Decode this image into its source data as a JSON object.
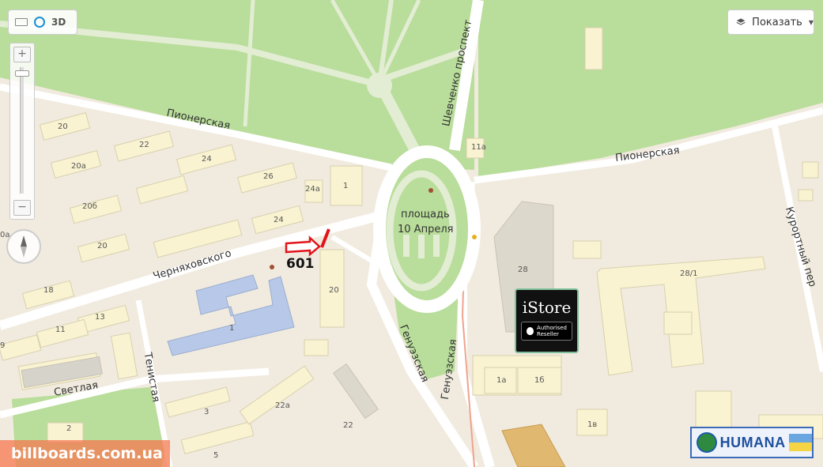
{
  "controls": {
    "mode_3d": "3D",
    "zoom_in": "+",
    "zoom_out": "−",
    "show_button": "Показать"
  },
  "streets": {
    "pionerskaya_left": "Пионерская",
    "pionerskaya_right": "Пионерская",
    "shevchenko": "Шевченко проспект",
    "chernyakhovskogo": "Черняховского",
    "genuezskaya_1": "Генуэзская",
    "genuezskaya_2": "Генуэзская",
    "kurortny": "Курортный пер",
    "svetlaya": "Светлая",
    "tenistaya": "Тенистая"
  },
  "square": {
    "line1": "площадь",
    "line2": "10 Апреля"
  },
  "building_numbers": [
    "20",
    "22",
    "20а",
    "24",
    "26",
    "24а",
    "1",
    "20б",
    "24",
    "20",
    "18",
    "13",
    "11",
    "9",
    "1",
    "20",
    "11а",
    "28",
    "28/1",
    "1а",
    "1б",
    "1в",
    "22а",
    "22",
    "3",
    "5",
    "2",
    "0а"
  ],
  "billboard": {
    "number": "601"
  },
  "ads": {
    "istore_title": "iStore",
    "istore_line1": "Authorised",
    "istore_line2": "Reseller",
    "humana": "HUMANA"
  },
  "watermark": "billboards.com.ua",
  "colors": {
    "park": "#b9dd9a",
    "land": "#f1ebdf",
    "building": "#f9f3d2",
    "building_edge": "#d8cfae",
    "road": "#ffffff",
    "school": "#b8c8e8",
    "pointer": "#e2131b"
  }
}
